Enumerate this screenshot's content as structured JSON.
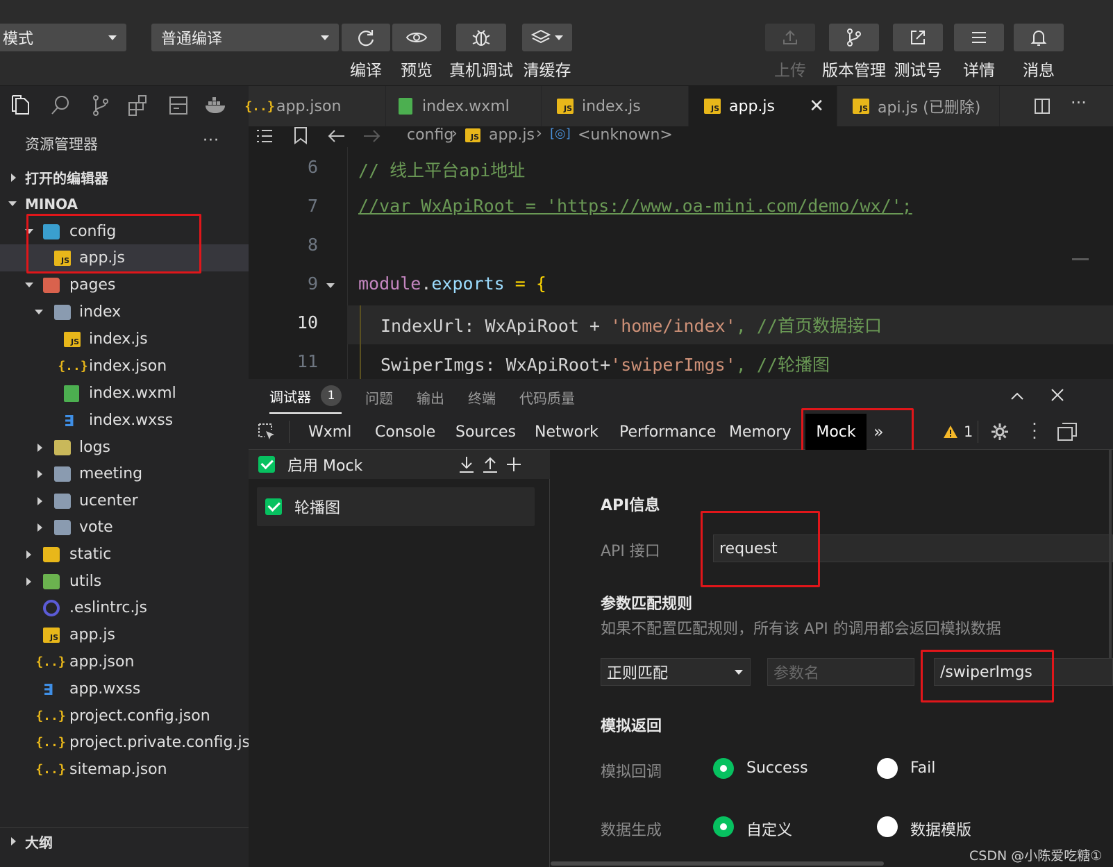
{
  "toolbar": {
    "mode_select": "模式",
    "compile_select": "普通编译",
    "compile": "编译",
    "preview": "预览",
    "remote_debug": "真机调试",
    "clear_cache": "清缓存",
    "upload": "上传",
    "version": "版本管理",
    "test_account": "测试号",
    "details": "详情",
    "messages": "消息"
  },
  "sidebar": {
    "title": "资源管理器",
    "more": "···",
    "open_editors": "打开的编辑器",
    "project": "MINOA",
    "outline": "大纲",
    "items": [
      {
        "label": "config",
        "icon": "folder-config-icon"
      },
      {
        "label": "app.js",
        "icon": "js-file-icon"
      },
      {
        "label": "pages",
        "icon": "folder-pages-icon"
      },
      {
        "label": "index",
        "icon": "folder-icon"
      },
      {
        "label": "index.js",
        "icon": "js-file-icon"
      },
      {
        "label": "index.json",
        "icon": "json-file-icon"
      },
      {
        "label": "index.wxml",
        "icon": "wxml-file-icon"
      },
      {
        "label": "index.wxss",
        "icon": "wxss-file-icon"
      },
      {
        "label": "logs",
        "icon": "folder-icon"
      },
      {
        "label": "meeting",
        "icon": "folder-icon"
      },
      {
        "label": "ucenter",
        "icon": "folder-icon"
      },
      {
        "label": "vote",
        "icon": "folder-icon"
      },
      {
        "label": "static",
        "icon": "folder-icon"
      },
      {
        "label": "utils",
        "icon": "folder-icon"
      },
      {
        "label": ".eslintrc.js",
        "icon": "eslint-icon"
      },
      {
        "label": "app.js",
        "icon": "js-file-icon"
      },
      {
        "label": "app.json",
        "icon": "json-file-icon"
      },
      {
        "label": "app.wxss",
        "icon": "wxss-file-icon"
      },
      {
        "label": "project.config.json",
        "icon": "json-file-icon"
      },
      {
        "label": "project.private.config.js...",
        "icon": "json-file-icon"
      },
      {
        "label": "sitemap.json",
        "icon": "json-file-icon"
      }
    ]
  },
  "tabs": [
    {
      "label": "app.json",
      "icon": "json-file-icon"
    },
    {
      "label": "index.wxml",
      "icon": "wxml-file-icon"
    },
    {
      "label": "index.js",
      "icon": "js-file-icon"
    },
    {
      "label": "app.js",
      "icon": "js-file-icon",
      "active": true
    },
    {
      "label": "api.js (已删除)",
      "icon": "js-file-icon"
    }
  ],
  "breadcrumb": {
    "folder": "config",
    "file": "app.js",
    "symbol": "<unknown>"
  },
  "editor": {
    "lines": [
      {
        "num": "6",
        "text": "// 线上平台api地址"
      },
      {
        "num": "7",
        "text": "//var WxApiRoot = 'https://www.oa-mini.com/demo/wx/';"
      },
      {
        "num": "8",
        "text": ""
      },
      {
        "num": "9",
        "kw": "module",
        "dot": ".",
        "prop": "exports",
        "rest": " = {"
      },
      {
        "num": "10",
        "key": "IndexUrl: WxApiRoot + ",
        "str": "'home/index'",
        "cmt": ", //首页数据接口"
      },
      {
        "num": "11",
        "key": "SwiperImgs: WxApiRoot+",
        "str": "'swiperImgs'",
        "cmt": ", //轮播图"
      }
    ]
  },
  "devtools": {
    "tabs_top": {
      "debugger": "调试器",
      "badge": "1",
      "issues": "问题",
      "output": "输出",
      "terminal": "终端",
      "quality": "代码质量"
    },
    "panel_tabs": [
      "Wxml",
      "Console",
      "Sources",
      "Network",
      "Performance",
      "Memory",
      "Mock",
      "»"
    ],
    "warning_count": "1"
  },
  "mock": {
    "enable_label": "启用 Mock",
    "rules": [
      {
        "label": "轮播图",
        "checked": true
      }
    ],
    "api_info_title": "API信息",
    "api_label": "API 接口",
    "api_value": "request",
    "param_rules_title": "参数匹配规则",
    "param_rules_desc": "如果不配置匹配规则，所有该 API 的调用都会返回模拟数据",
    "match_type": "正则匹配",
    "param_name_placeholder": "参数名",
    "param_value": "/swiperImgs",
    "mock_return_title": "模拟返回",
    "callback_label": "模拟回调",
    "callback_success": "Success",
    "callback_fail": "Fail",
    "datagen_label": "数据生成",
    "datagen_custom": "自定义",
    "datagen_template": "数据模版"
  },
  "watermark": "CSDN @小陈爱吃糖①",
  "colors": {
    "accent_green": "#07c160",
    "highlight_red": "#e0161a",
    "js_yellow": "#e8b71a"
  }
}
